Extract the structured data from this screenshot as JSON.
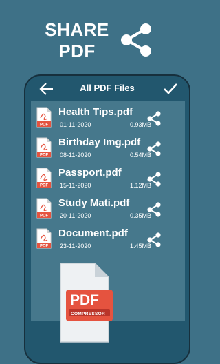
{
  "hero": {
    "title_line1": "SHARE",
    "title_line2": "PDF"
  },
  "appbar": {
    "title": "All PDF Files",
    "back_icon": "arrow-left-icon",
    "confirm_icon": "check-icon"
  },
  "files": [
    {
      "name": "Health Tips.pdf",
      "date": "01-11-2020",
      "size": "0.93MB"
    },
    {
      "name": "Birthday Img.pdf",
      "date": "08-11-2020",
      "size": "0.54MB"
    },
    {
      "name": "Passport.pdf",
      "date": "15-11-2020",
      "size": "1.12MB"
    },
    {
      "name": "Study Mati.pdf",
      "date": "20-11-2020",
      "size": "0.35MB"
    },
    {
      "name": "Document.pdf",
      "date": "23-11-2020",
      "size": "1.45MB"
    }
  ],
  "file_icon_label": "PDF",
  "compressor": {
    "badge": "PDF",
    "label": "COMPRESSOR"
  },
  "colors": {
    "background": "#3e7187",
    "phone": "#22576e",
    "list": "#46788c",
    "accent_red": "#e5533f"
  }
}
